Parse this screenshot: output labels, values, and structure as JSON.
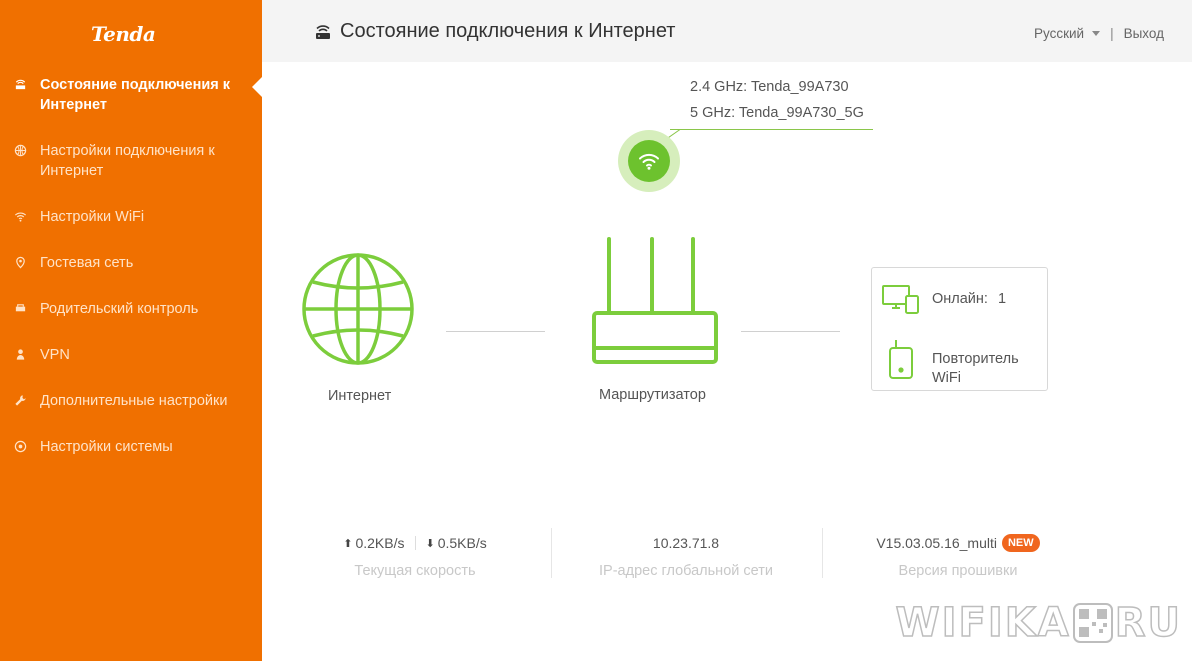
{
  "brand": {
    "logo": "Tenda",
    "accent": "#f07000",
    "green": "#6dc22e"
  },
  "sidebar": {
    "items": [
      {
        "label": "Состояние подключения к Интернет",
        "icon": "router-status-icon",
        "active": true
      },
      {
        "label": "Настройки подключения к Интернет",
        "icon": "globe-icon"
      },
      {
        "label": "Настройки WiFi",
        "icon": "wifi-icon"
      },
      {
        "label": "Гостевая сеть",
        "icon": "guest-icon"
      },
      {
        "label": "Родительский контроль",
        "icon": "parental-icon"
      },
      {
        "label": "VPN",
        "icon": "vpn-icon"
      },
      {
        "label": "Дополнительные настройки",
        "icon": "wrench-icon"
      },
      {
        "label": "Настройки системы",
        "icon": "system-icon"
      }
    ]
  },
  "header": {
    "title": "Состояние подключения к Интернет",
    "language": "Русский",
    "separator": "|",
    "logout": "Выход"
  },
  "diagram": {
    "ssid_24": "2.4 GHz: Tenda_99A730",
    "ssid_5": "5 GHz: Tenda_99A730_5G",
    "internet_label": "Интернет",
    "router_label": "Маршрутизатор",
    "online_label": "Онлайн:",
    "online_count": "1",
    "repeater_label": "Повторитель WiFi"
  },
  "stats": {
    "upload": "0.2KB/s",
    "download": "0.5KB/s",
    "speed_label": "Текущая скорость",
    "ip": "10.23.71.8",
    "ip_label": "IP-адрес глобальной сети",
    "firmware": "V15.03.05.16_multi",
    "new_badge": "NEW",
    "firmware_label": "Версия прошивки"
  },
  "watermark": {
    "left": "WIFIKA",
    "right": "RU"
  }
}
